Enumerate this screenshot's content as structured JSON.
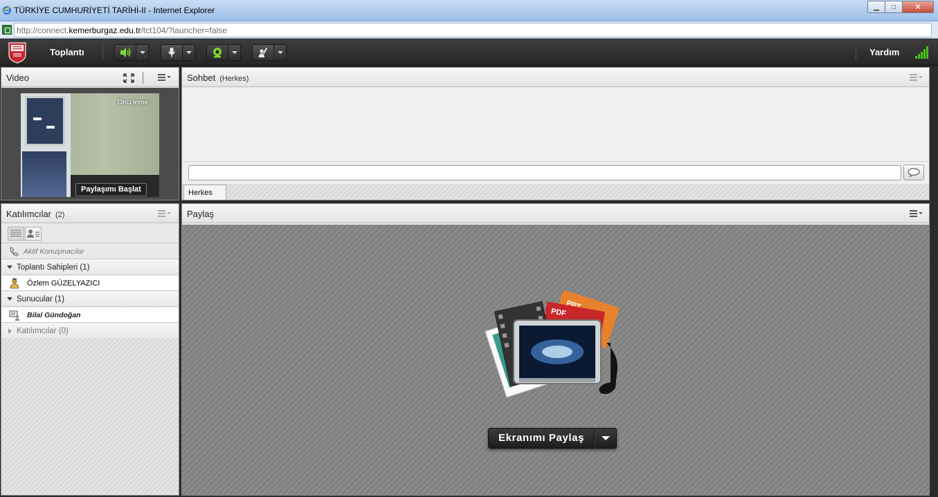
{
  "window": {
    "title": "TÜRKİYE CUMHURİYETİ TARİHİ-II - Internet Explorer",
    "minimize": "▁",
    "maximize": "□",
    "close": "✕"
  },
  "address": {
    "prefix": "http://connect.",
    "domain": "kemerburgaz.edu.tr",
    "path": "/tct104/?launcher=false"
  },
  "toolbar": {
    "meeting_label": "Toplantı",
    "help_label": "Yardım",
    "colors": {
      "active_green": "#7bdc2b",
      "signal": "#43c51c"
    }
  },
  "video": {
    "title": "Video",
    "preview_label": "Önizleme",
    "start_sharing": "Paylaşımı Başlat"
  },
  "chat": {
    "title": "Sohbet",
    "scope": "(Herkes)",
    "input_value": "",
    "tab_label": "Herkes"
  },
  "participants": {
    "title": "Katılımcılar",
    "count": "(2)",
    "active_speakers": "Aktif Konuşmacılar",
    "sections": [
      {
        "label": "Toplantı Sahipleri (1)",
        "members": [
          "Özlem GÜZELYAZICI"
        ]
      },
      {
        "label": "Sunucular (1)",
        "members": [
          "Bilal Gündoğan"
        ]
      },
      {
        "label": "Katılımcılar (0)",
        "members": []
      }
    ]
  },
  "share": {
    "title": "Paylaş",
    "share_screen_button": "Ekranımı Paylaş",
    "art_labels": {
      "ppt": "PPT",
      "pdf": "PDF"
    }
  }
}
